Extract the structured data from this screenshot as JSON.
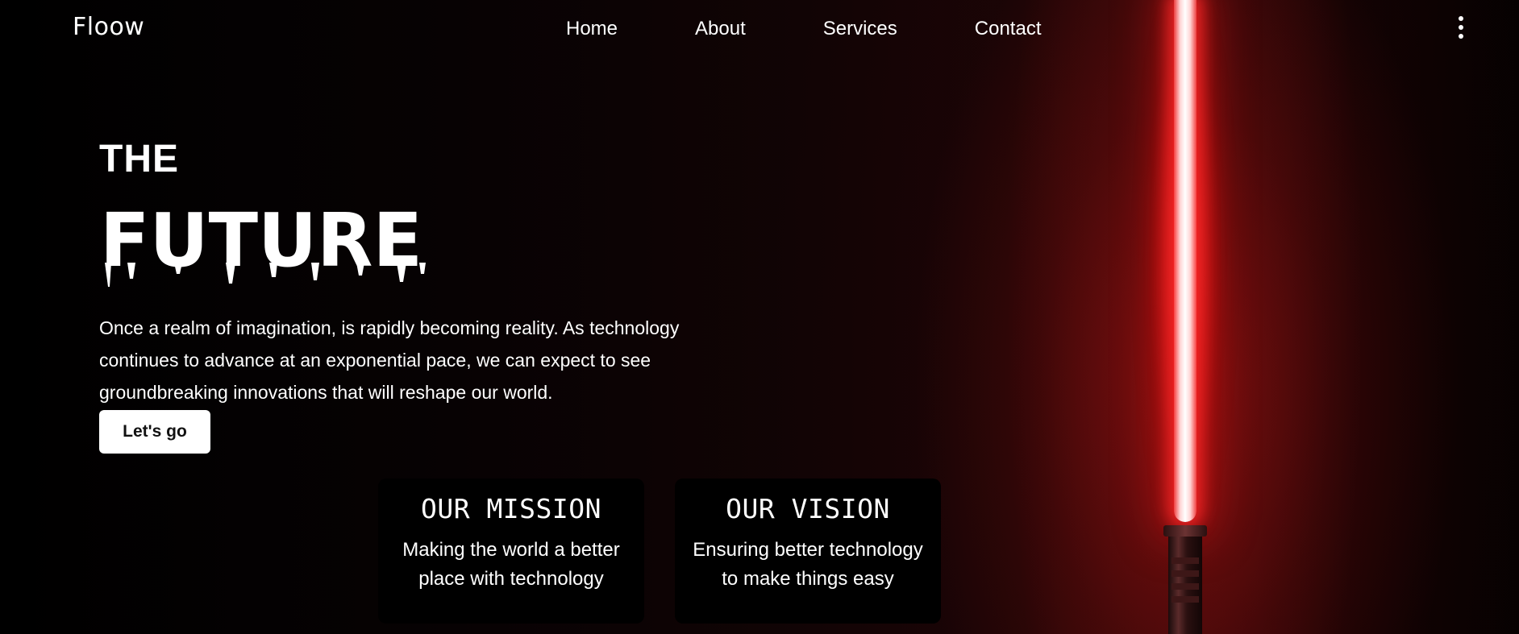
{
  "brand": {
    "logo": "Floow"
  },
  "nav": {
    "links": [
      "Home",
      "About",
      "Services",
      "Contact"
    ]
  },
  "hero": {
    "line1": "THE",
    "line2": "FUTURE",
    "description": "Once a realm of imagination, is rapidly becoming reality. As technology continues to advance at an exponential pace, we can expect to see groundbreaking innovations that will reshape our world.",
    "cta_label": "Let's go"
  },
  "cards": [
    {
      "title": "OUR MISSION",
      "text": "Making the world a better place with technology"
    },
    {
      "title": "OUR VISION",
      "text": "Ensuring better technology to make things easy"
    }
  ],
  "icons": {
    "menu": "kebab-menu-icon",
    "saber": "lightsaber-illustration"
  },
  "colors": {
    "background": "#000000",
    "accent": "#e01e1e",
    "text": "#ffffff",
    "button_bg": "#ffffff"
  }
}
